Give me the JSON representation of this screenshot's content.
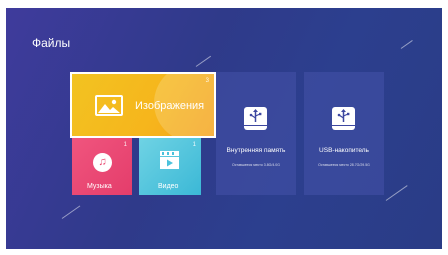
{
  "header": {
    "title": "Файлы"
  },
  "tiles": {
    "images": {
      "label": "Изображения",
      "count": "3"
    },
    "music": {
      "label": "Музыка",
      "count": "1"
    },
    "video": {
      "label": "Видео",
      "count": "1"
    }
  },
  "storage": {
    "internal": {
      "name": "Внутренняя память",
      "free": "Оставшееся место 3.8G/4.0G"
    },
    "usb": {
      "name": "USB-накопитель",
      "free": "Оставшееся место 28.7G/29.5G"
    }
  },
  "icons": {
    "images": "image-icon",
    "music": "music-note-icon",
    "video": "video-clapper-icon",
    "internal": "storage-drive-icon",
    "usb": "usb-drive-icon"
  },
  "colors": {
    "background": "#2f3a8a",
    "images_tile": "#f4b81c",
    "music_tile": "#e8466f",
    "video_tile": "#4cc2dc",
    "storage_tile": "#4552aa"
  }
}
